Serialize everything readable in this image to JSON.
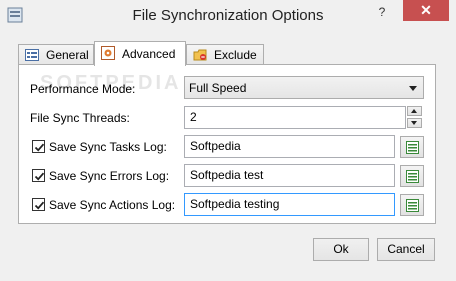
{
  "window": {
    "title": "File Synchronization Options",
    "help_label": "?",
    "close_label": "✕"
  },
  "tabs": [
    {
      "label": "General",
      "icon": "general-icon"
    },
    {
      "label": "Advanced",
      "icon": "advanced-icon"
    },
    {
      "label": "Exclude",
      "icon": "exclude-icon"
    }
  ],
  "watermark": "SOFTPEDIA",
  "form": {
    "performance_label": "Performance Mode:",
    "performance_value": "Full Speed",
    "threads_label": "File Sync Threads:",
    "threads_value": "2",
    "tasks_log_label": "Save Sync Tasks Log:",
    "tasks_log_value": "Softpedia",
    "tasks_log_checked": true,
    "errors_log_label": "Save Sync Errors Log:",
    "errors_log_value": "Softpedia test",
    "errors_log_checked": true,
    "actions_log_label": "Save Sync Actions Log:",
    "actions_log_value": "Softpedia testing",
    "actions_log_checked": true
  },
  "buttons": {
    "ok": "Ok",
    "cancel": "Cancel"
  },
  "colors": {
    "close_button": "#c75050",
    "focus_border": "#3399ff"
  }
}
